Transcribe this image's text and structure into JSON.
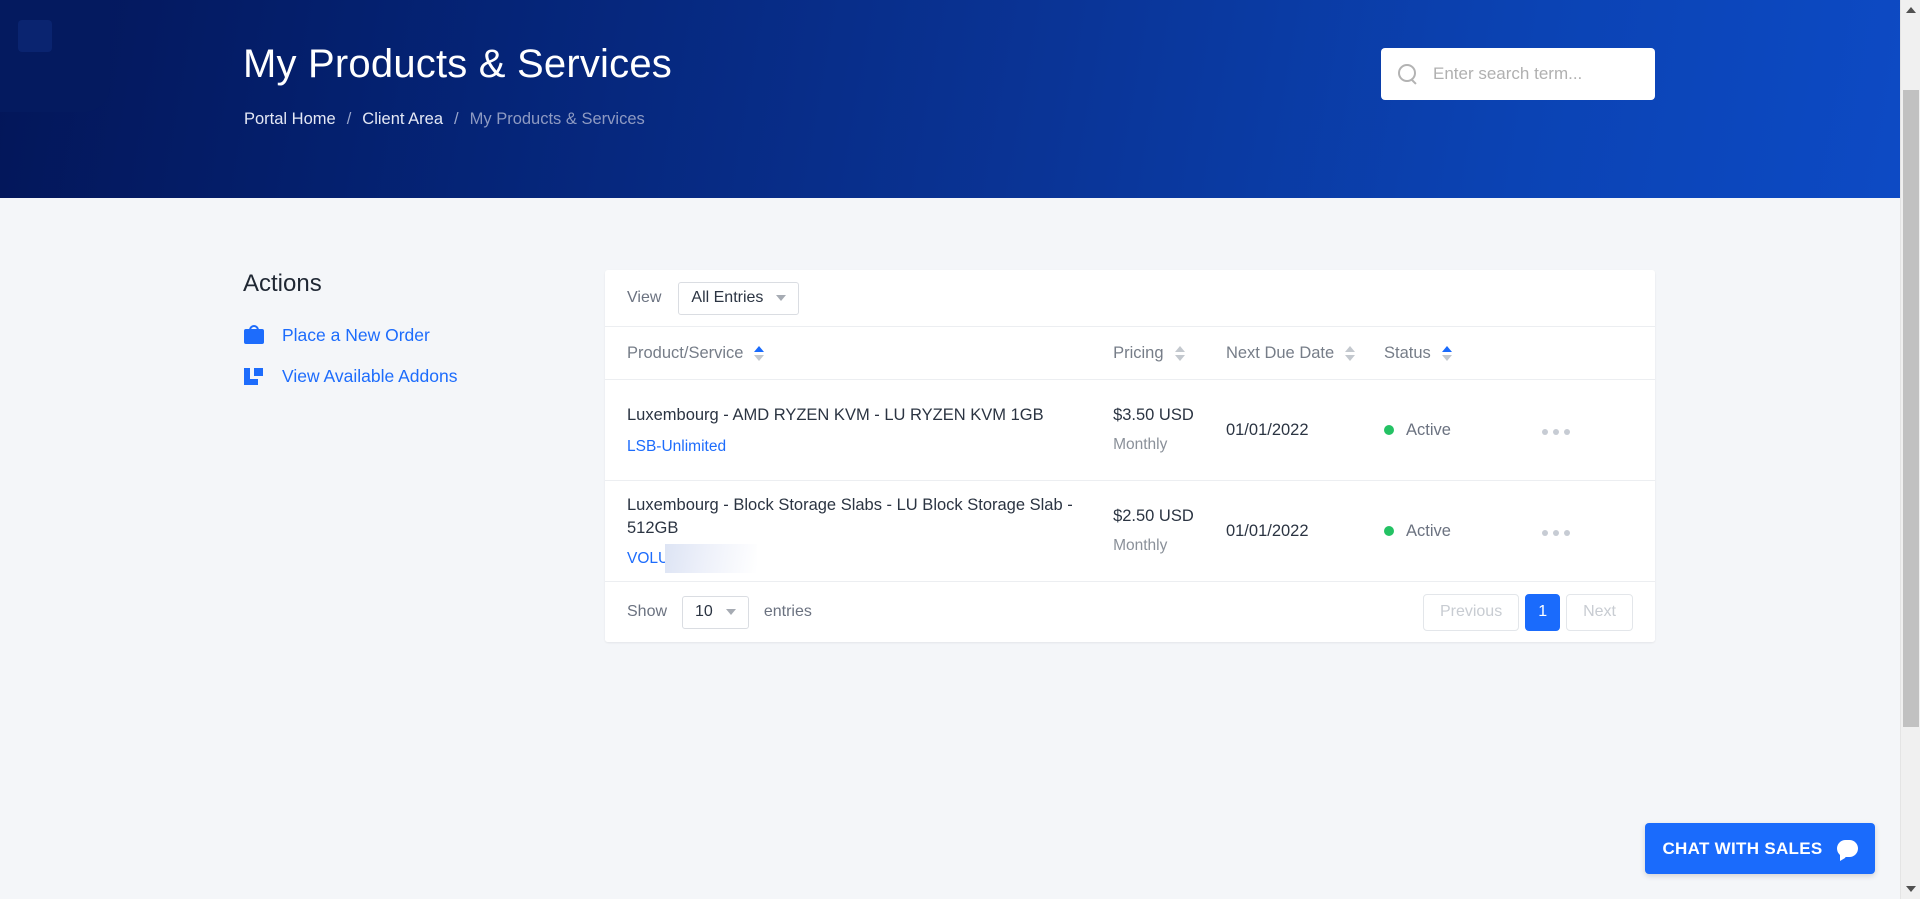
{
  "header": {
    "title": "My Products & Services",
    "breadcrumb": [
      {
        "label": "Portal Home",
        "current": false
      },
      {
        "label": "Client Area",
        "current": false
      },
      {
        "label": "My Products & Services",
        "current": true
      }
    ],
    "separator": "/",
    "gradient_from": "#031659",
    "gradient_to": "#0d4ac4"
  },
  "search": {
    "placeholder": "Enter search term...",
    "value": "",
    "icon": "search-icon"
  },
  "actions": {
    "title": "Actions",
    "items": [
      {
        "label": "Place a New Order",
        "icon": "shopping-bag-icon"
      },
      {
        "label": "View Available Addons",
        "icon": "addon-expand-icon"
      }
    ],
    "link_color": "#1d6cfc"
  },
  "table_toolbar": {
    "view_label": "View",
    "view_selected": "All Entries",
    "view_options": [
      "All Entries"
    ],
    "caret_icon": "chevron-down-icon"
  },
  "table": {
    "columns": [
      {
        "label": "Product/Service",
        "sortable": true,
        "sort_state": "asc"
      },
      {
        "label": "Pricing",
        "sortable": true,
        "sort_state": "none"
      },
      {
        "label": "Next Due Date",
        "sortable": true,
        "sort_state": "none"
      },
      {
        "label": "Status",
        "sortable": true,
        "sort_state": "asc"
      },
      {
        "label": "",
        "sortable": false,
        "sort_state": "none"
      }
    ],
    "rows": [
      {
        "product": "Luxembourg - AMD RYZEN KVM - LU RYZEN KVM 1GB",
        "domain": "LSB-Unlimited",
        "domain_redacted": false,
        "price": "$3.50 USD",
        "billing_cycle": "Monthly",
        "next_due_date": "01/01/2022",
        "status": "Active",
        "status_color": "#24c264",
        "actions_icon": "ellipsis-horizontal-icon"
      },
      {
        "product": "Luxembourg - Block Storage Slabs - LU Block Storage Slab - 512GB",
        "domain": "VOLUM",
        "domain_redacted": true,
        "price": "$2.50 USD",
        "billing_cycle": "Monthly",
        "next_due_date": "01/01/2022",
        "status": "Active",
        "status_color": "#24c264",
        "actions_icon": "ellipsis-horizontal-icon"
      }
    ]
  },
  "table_footer": {
    "show_label": "Show",
    "page_size": "10",
    "page_size_options": [
      "10"
    ],
    "entries_label": "entries",
    "previous_label": "Previous",
    "next_label": "Next",
    "current_page": "1",
    "active_page_color": "#1a6bfc"
  },
  "chat_widget": {
    "label": "CHAT WITH SALES",
    "icon": "chat-bubble-icon",
    "color": "#1a6bfc"
  },
  "scrollbar": {
    "up_icon": "chevron-up-icon",
    "down_icon": "chevron-down-icon"
  }
}
